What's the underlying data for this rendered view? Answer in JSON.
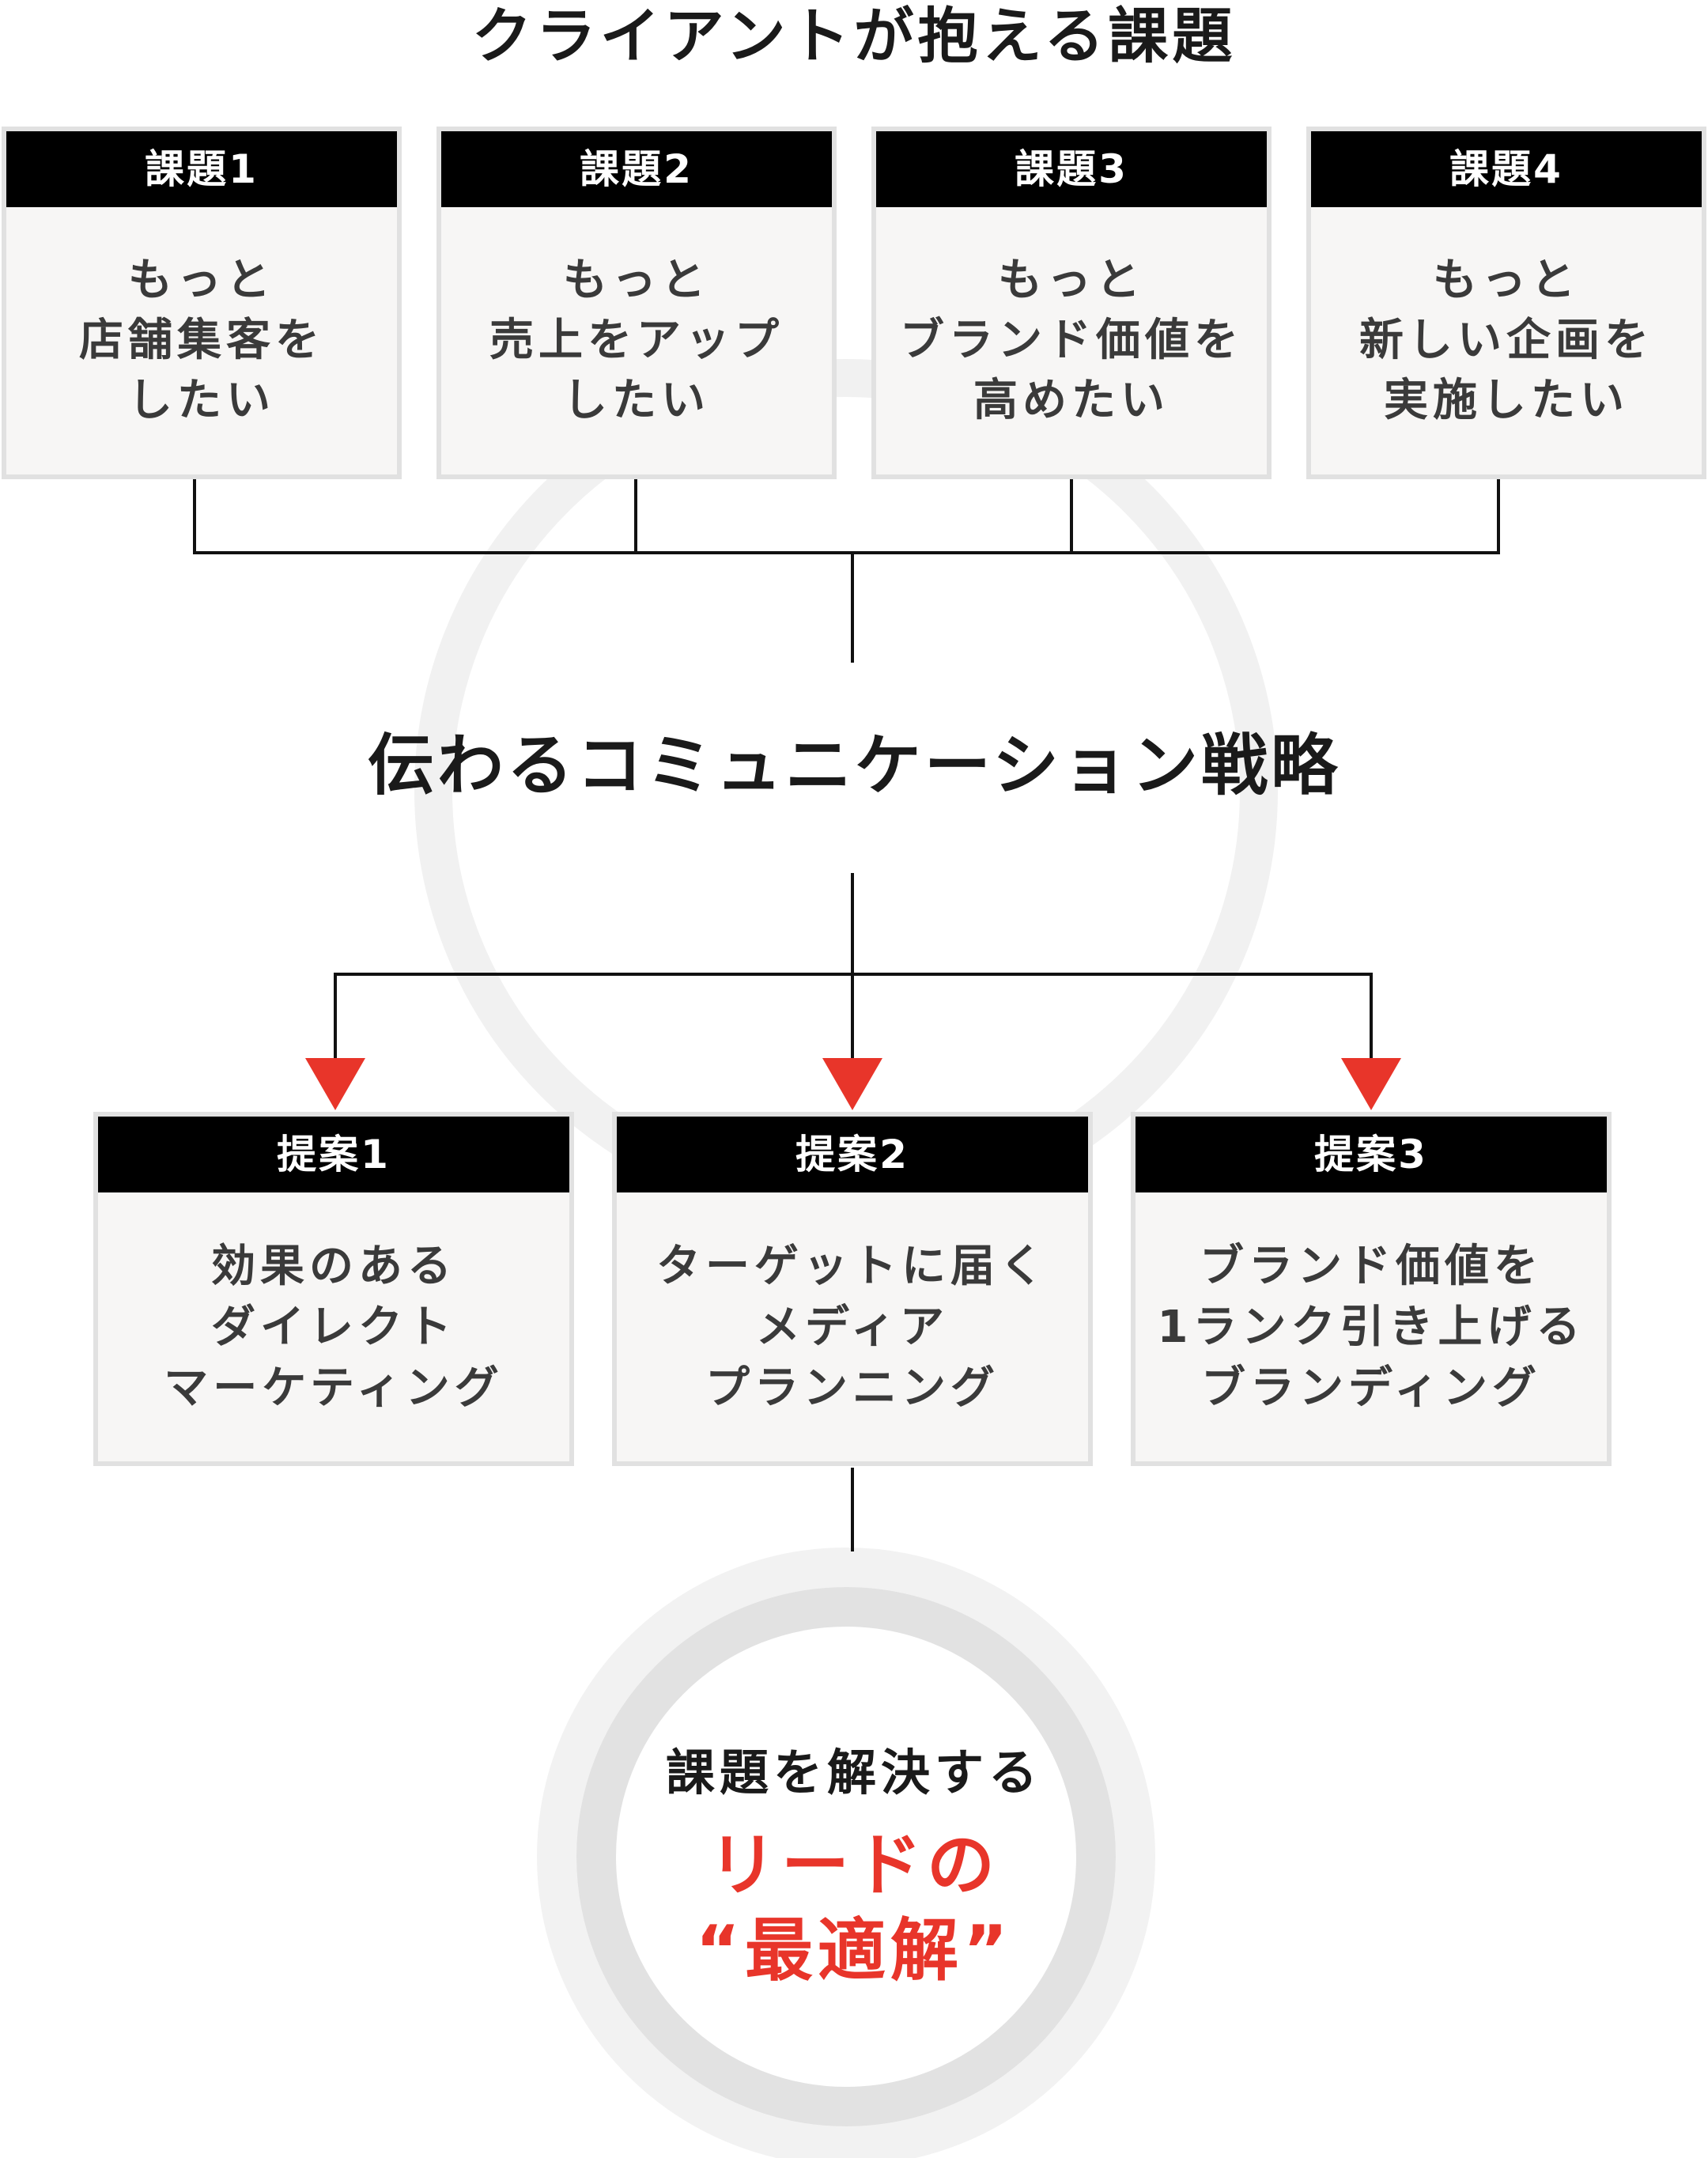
{
  "title": "クライアントが抱える課題",
  "issues": [
    {
      "label": "課題1",
      "lines": [
        "もっと",
        "店舗集客を",
        "したい"
      ]
    },
    {
      "label": "課題2",
      "lines": [
        "もっと",
        "売上をアップ",
        "したい"
      ]
    },
    {
      "label": "課題3",
      "lines": [
        "もっと",
        "ブランド価値を",
        "高めたい"
      ]
    },
    {
      "label": "課題4",
      "lines": [
        "もっと",
        "新しい企画を",
        "実施したい"
      ]
    }
  ],
  "strategy_title": "伝わるコミュニケーション戦略",
  "proposals": [
    {
      "label": "提案1",
      "lines": [
        "効果のある",
        "ダイレクト",
        "マーケティング"
      ]
    },
    {
      "label": "提案2",
      "lines": [
        "ターゲットに届く",
        "メディア",
        "プランニング"
      ]
    },
    {
      "label": "提案3",
      "lines": [
        "ブランド価値を",
        "1ランク引き上げる",
        "ブランディング"
      ]
    }
  ],
  "result": {
    "lead": "課題を解決する",
    "line1": "リードの",
    "line2": "“最適解”"
  },
  "colors": {
    "accent": "#e8352a",
    "header_bg": "#000000",
    "card_bg": "#f7f6f5",
    "card_border": "#e1e1e1",
    "ring_light": "#f2f2f2",
    "ring_mid": "#e2e2e2",
    "connector": "#111111"
  }
}
